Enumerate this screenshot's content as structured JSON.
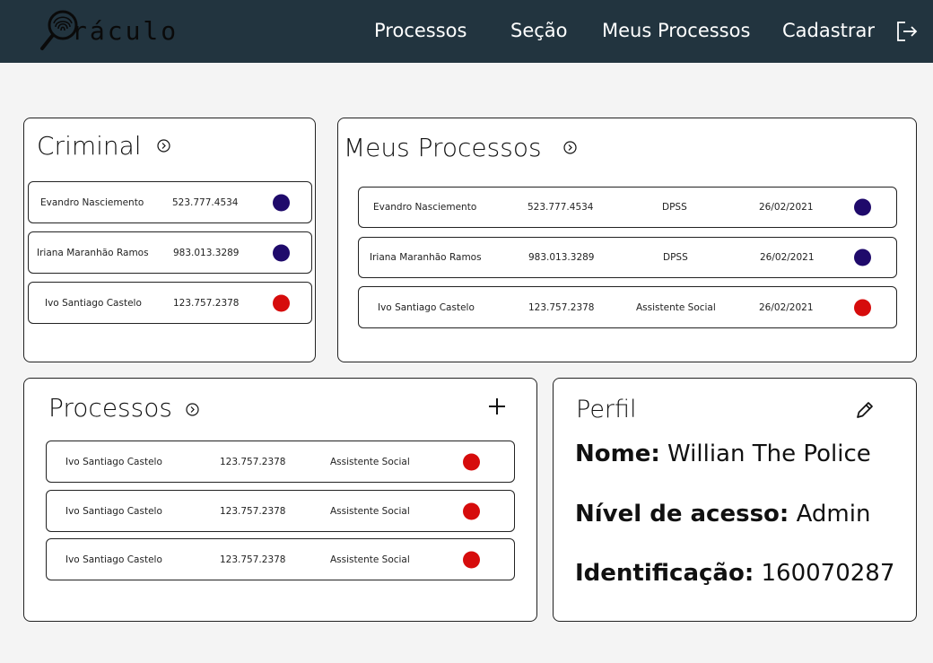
{
  "header": {
    "logo_text": "ráculo",
    "nav": [
      "Processos",
      "Seção",
      "Meus Processos",
      "Cadastrar"
    ]
  },
  "criminal": {
    "title": "Criminal",
    "rows": [
      {
        "name": "Evandro Nasciemento",
        "phone": "523.777.4534",
        "status_color": "#1f0a6b"
      },
      {
        "name": "Iriana Maranhão Ramos",
        "phone": "983.013.3289",
        "status_color": "#1f0a6b"
      },
      {
        "name": "Ivo Santiago Castelo",
        "phone": "123.757.2378",
        "status_color": "#d60c0c"
      }
    ]
  },
  "meus_processos": {
    "title": "Meus Processos",
    "rows": [
      {
        "name": "Evandro Nasciemento",
        "phone": "523.777.4534",
        "section": "DPSS",
        "date": "26/02/2021",
        "status_color": "#1f0a6b"
      },
      {
        "name": "Iriana Maranhão Ramos",
        "phone": "983.013.3289",
        "section": "DPSS",
        "date": "26/02/2021",
        "status_color": "#1f0a6b"
      },
      {
        "name": "Ivo Santiago Castelo",
        "phone": "123.757.2378",
        "section": "Assistente Social",
        "date": "26/02/2021",
        "status_color": "#d60c0c"
      }
    ]
  },
  "processos": {
    "title": "Processos",
    "rows": [
      {
        "name": "Ivo Santiago Castelo",
        "phone": "123.757.2378",
        "section": "Assistente Social",
        "status_color": "#d60c0c"
      },
      {
        "name": "Ivo Santiago Castelo",
        "phone": "123.757.2378",
        "section": "Assistente Social",
        "status_color": "#d60c0c"
      },
      {
        "name": "Ivo Santiago Castelo",
        "phone": "123.757.2378",
        "section": "Assistente Social",
        "status_color": "#d60c0c"
      }
    ]
  },
  "perfil": {
    "title": "Perfil",
    "nome_label": "Nome:",
    "nome_value": "Willian The Police",
    "nivel_label": "Nível de acesso:",
    "nivel_value": "Admin",
    "id_label": "Identificação:",
    "id_value": "160070287"
  }
}
